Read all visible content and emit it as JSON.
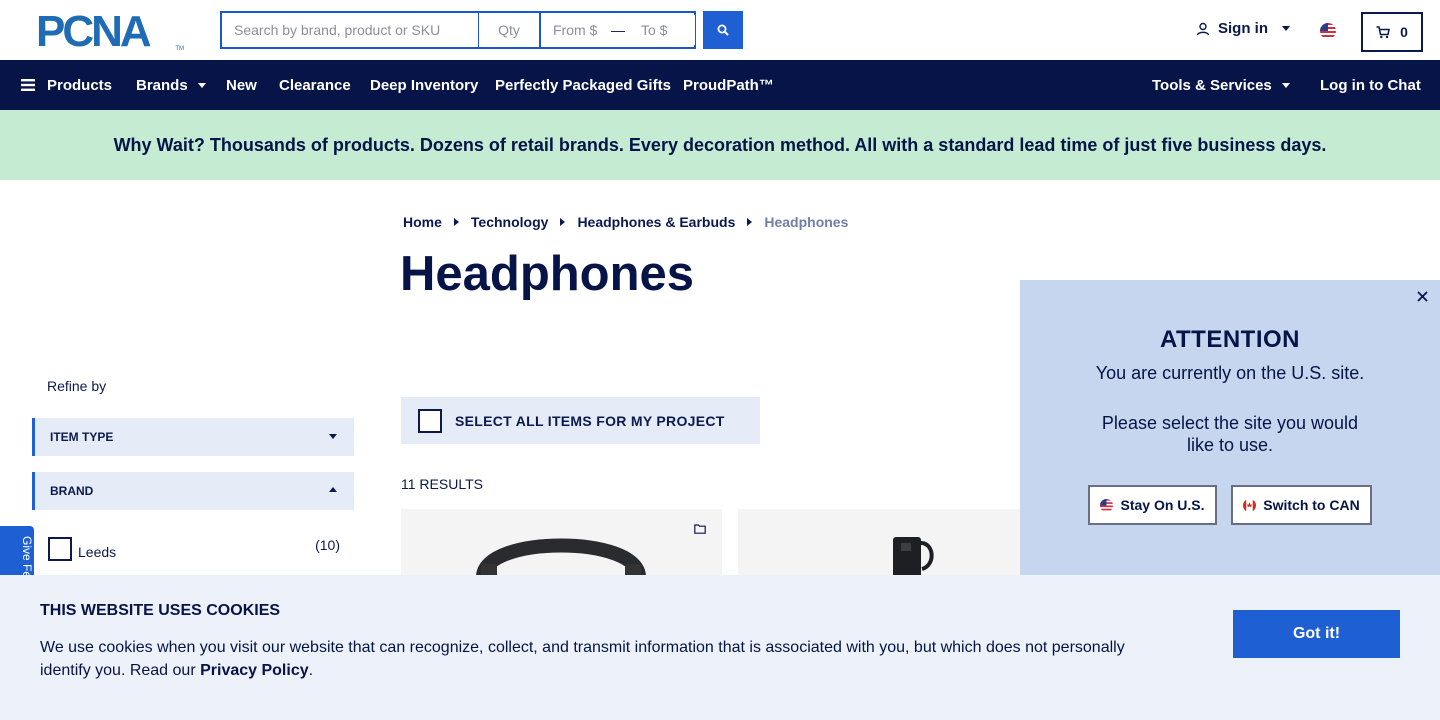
{
  "header": {
    "logo_text": "PCNA",
    "logo_tm": "TM",
    "search": {
      "placeholder": "Search by brand, product or SKU",
      "value": ""
    },
    "qty": {
      "placeholder": "Qty"
    },
    "price_from": {
      "placeholder": "From $"
    },
    "price_to": {
      "placeholder": "To $"
    },
    "sign_in_label": "Sign in",
    "cart_count": "0"
  },
  "nav": {
    "products": "Products",
    "brands": "Brands",
    "new": "New",
    "clearance": "Clearance",
    "deep_inventory": "Deep Inventory",
    "gifts": "Perfectly Packaged Gifts",
    "proudpath": "ProudPath™",
    "tools": "Tools & Services",
    "chat": "Log in to Chat"
  },
  "promo": {
    "text": "Why Wait? Thousands of products. Dozens of retail brands. Every decoration method. All with a standard lead time of just five business days."
  },
  "breadcrumb": {
    "items": [
      "Home",
      "Technology",
      "Headphones & Earbuds"
    ],
    "current": "Headphones"
  },
  "page_title": "Headphones",
  "sidebar": {
    "refine_label": "Refine by",
    "facets": [
      {
        "label": "ITEM TYPE"
      },
      {
        "label": "BRAND"
      }
    ],
    "brand_options": [
      {
        "label": "Leeds",
        "count": "(10)"
      }
    ],
    "feedback_label": "Give Fe"
  },
  "results": {
    "select_all_label": "SELECT ALL ITEMS FOR MY PROJECT",
    "count_label": "11 RESULTS"
  },
  "attention": {
    "title": "ATTENTION",
    "line1": "You are currently on the U.S. site.",
    "line2": "Please select the site you would like to use.",
    "stay_label": "Stay On U.S.",
    "switch_label": "Switch to CAN"
  },
  "cookie": {
    "title": "THIS WEBSITE USES COOKIES",
    "text": "We use cookies when you visit our website that can recognize, collect, and transmit information that is associated with you, but which does not personally identify you. Read our ",
    "link": "Privacy Policy",
    "end": ".",
    "button": "Got it!"
  },
  "colors": {
    "navy": "#061448",
    "accent_blue": "#1f5fd4",
    "promo_green": "#c5ecd3",
    "modal_blue": "#c6d6ee",
    "logo_blue": "#1f6bb4"
  }
}
